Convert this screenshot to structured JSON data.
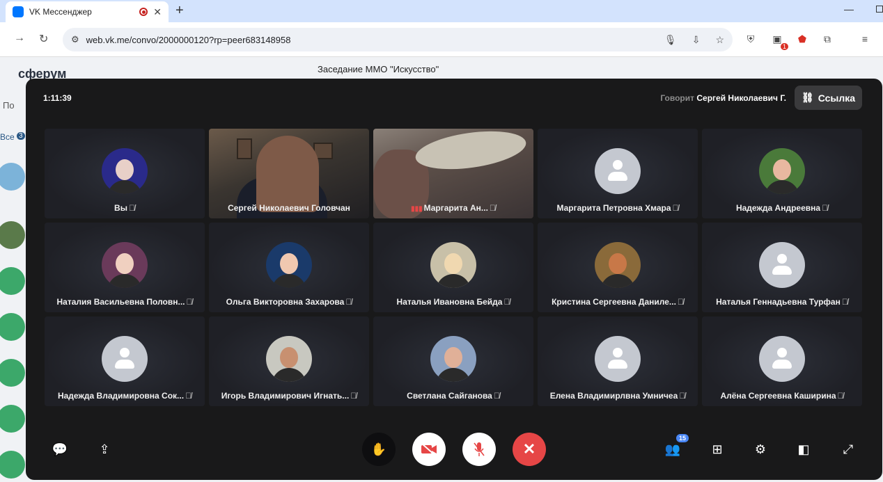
{
  "browser": {
    "tab_title": "VK Мессенджер",
    "url": "web.vk.me/convo/2000000120?rp=peer683148958",
    "ext_badge": "1"
  },
  "background": {
    "logo": "сферум",
    "chat_title": "Заседание ММО \"Искусство\"",
    "search_placeholder": "По",
    "all_label": "Все",
    "all_count": "3"
  },
  "call": {
    "timer": "1:11:39",
    "speaking_label": "Говорит",
    "speaking_name": "Сергей Николаевич Г.",
    "link_button": "Ссылка",
    "participants_count": "15",
    "participants": [
      {
        "name": "Вы",
        "muted": true,
        "kind": "photo",
        "photo_color": "#2a2a8a",
        "accent": "#e8d0c8"
      },
      {
        "name": "Сергей Николаевич Головчан",
        "muted": false,
        "kind": "video1"
      },
      {
        "name": "Маргарита Ан...",
        "muted": true,
        "kind": "video2",
        "signal": true
      },
      {
        "name": "Маргарита Петровна Хмара",
        "muted": true,
        "kind": "default"
      },
      {
        "name": "Надежда Андреевна",
        "muted": true,
        "kind": "photo",
        "photo_color": "#4a7a3a",
        "accent": "#e8b8a0"
      },
      {
        "name": "Наталия Васильевна Половн...",
        "muted": true,
        "kind": "photo",
        "photo_color": "#6a3a5a",
        "accent": "#f0d0c0"
      },
      {
        "name": "Ольга Викторовна Захарова",
        "muted": true,
        "kind": "photo",
        "photo_color": "#1a3a6a",
        "accent": "#f0c8b0"
      },
      {
        "name": "Наталья Ивановна Бейда",
        "muted": true,
        "kind": "photo",
        "photo_color": "#c8c0a8",
        "accent": "#f0d8b0"
      },
      {
        "name": "Кристина Сергеевна Даниле...",
        "muted": true,
        "kind": "photo",
        "photo_color": "#8a6a3a",
        "accent": "#c87848"
      },
      {
        "name": "Наталья Геннадьевна Турфан",
        "muted": true,
        "kind": "default"
      },
      {
        "name": "Надежда Владимировна Сок...",
        "muted": true,
        "kind": "default"
      },
      {
        "name": "Игорь Владимирович Игнать...",
        "muted": true,
        "kind": "photo",
        "photo_color": "#c8c8c0",
        "accent": "#c89070"
      },
      {
        "name": "Светлана Сайганова",
        "muted": true,
        "kind": "photo",
        "photo_color": "#8aa0c0",
        "accent": "#e0b098"
      },
      {
        "name": "Елена Владимирлвна Умничеа",
        "muted": true,
        "kind": "default"
      },
      {
        "name": "Алёна Сергеевна Каширина",
        "muted": true,
        "kind": "default"
      }
    ]
  },
  "icons": {
    "mic_off": "🎙",
    "link": "🔗"
  }
}
